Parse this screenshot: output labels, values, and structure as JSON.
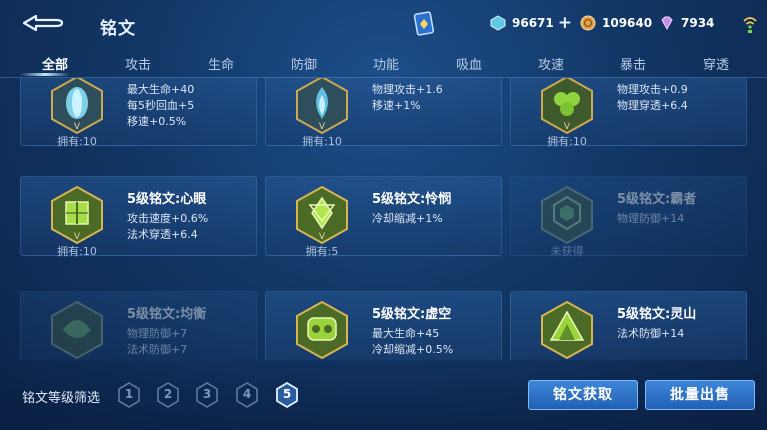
{
  "header": {
    "title": "铭文",
    "currency": [
      {
        "name": "diamond-icon",
        "value": "96671",
        "color": "#5fc8e8"
      },
      {
        "name": "gold-coin-icon",
        "value": "109640",
        "color": "#e0a34a"
      },
      {
        "name": "gem-icon",
        "value": "7934",
        "color": "#c78cf0"
      }
    ],
    "plus": "+"
  },
  "tabs": [
    "全部",
    "攻击",
    "生命",
    "防御",
    "功能",
    "吸血",
    "攻速",
    "暴击",
    "穿透"
  ],
  "cards": [
    {
      "name": "",
      "stats": [
        "最大生命+40",
        "每5秒回血+5",
        "移速+0.5%"
      ],
      "owned": "拥有:10",
      "icon": "tulip-inscription-icon",
      "color": "#5fb6d6"
    },
    {
      "name": "",
      "stats": [
        "物理攻击+1.6",
        "移速+1%"
      ],
      "owned": "拥有:10",
      "icon": "blue-flame-inscription-icon",
      "color": "#4fb7d8"
    },
    {
      "name": "",
      "stats": [
        "物理攻击+0.9",
        "物理穿透+6.4"
      ],
      "owned": "拥有:10",
      "icon": "green-clover-inscription-icon",
      "color": "#7fcf3e"
    },
    {
      "name": "5级铭文:心眼",
      "stats": [
        "攻击速度+0.6%",
        "法术穿透+6.4"
      ],
      "owned": "拥有:10",
      "icon": "mind-eye-inscription-icon",
      "color": "#8fd040"
    },
    {
      "name": "5级铭文:怜悯",
      "stats": [
        "冷却缩减+1%"
      ],
      "owned": "拥有:5",
      "icon": "mercy-inscription-icon",
      "color": "#9ad43a"
    },
    {
      "name": "5级铭文:霸者",
      "stats": [
        "物理防御+14"
      ],
      "owned": "未获得",
      "icon": "overlord-inscription-icon",
      "color": "#6fae6a"
    },
    {
      "name": "5级铭文:均衡",
      "stats": [
        "物理防御+7",
        "法术防御+7"
      ],
      "owned": "",
      "icon": "balance-inscription-icon",
      "color": "#6fae6a"
    },
    {
      "name": "5级铭文:虚空",
      "stats": [
        "最大生命+45",
        "冷却缩减+0.5%"
      ],
      "owned": "",
      "icon": "void-inscription-icon",
      "color": "#8fd040"
    },
    {
      "name": "5级铭文:灵山",
      "stats": [
        "法术防御+14"
      ],
      "owned": "",
      "icon": "spirit-mountain-inscription-icon",
      "color": "#8fd040"
    }
  ],
  "filter": {
    "label": "铭文等级筛选",
    "levels": [
      "1",
      "2",
      "3",
      "4",
      "5"
    ],
    "selected": "5"
  },
  "buttons": {
    "acquire": "铭文获取",
    "sell": "批量出售"
  }
}
